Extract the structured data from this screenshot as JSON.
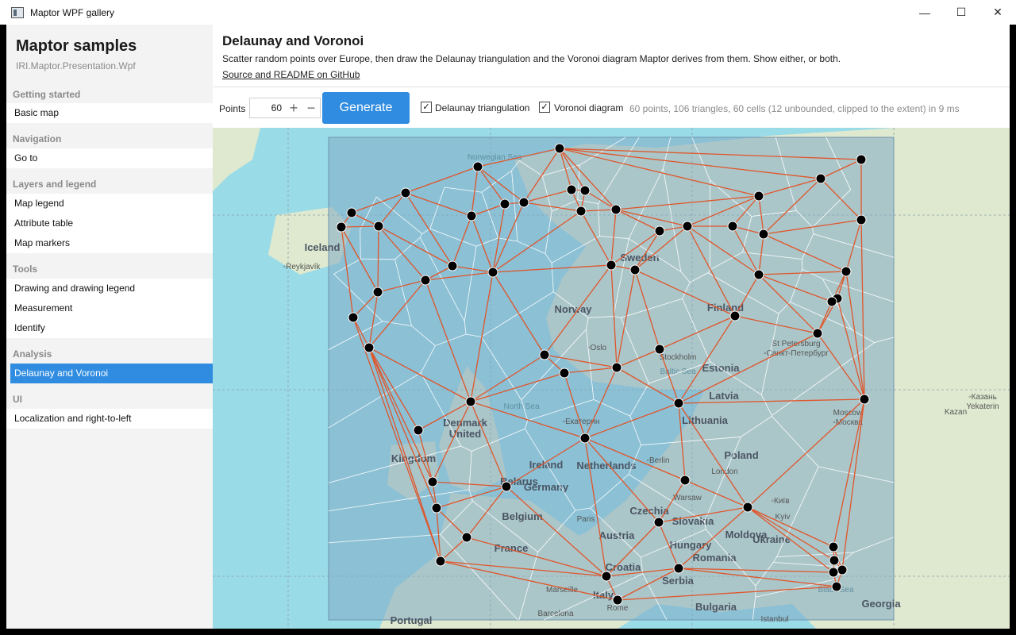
{
  "window": {
    "title": "Maptor WPF gallery",
    "controls": {
      "minimize": "—",
      "maximize": "☐",
      "close": "✕"
    }
  },
  "sidebar": {
    "title": "Maptor samples",
    "subtitle": "IRI.Maptor.Presentation.Wpf",
    "groups": [
      {
        "label": "Getting started",
        "items": [
          "Basic map"
        ]
      },
      {
        "label": "Navigation",
        "items": [
          "Go to"
        ]
      },
      {
        "label": "Layers and legend",
        "items": [
          "Map legend",
          "Attribute table",
          "Map markers"
        ]
      },
      {
        "label": "Tools",
        "items": [
          "Drawing and drawing legend",
          "Measurement",
          "Identify"
        ]
      },
      {
        "label": "Analysis",
        "items": [
          "Delaunay and Voronoi"
        ]
      },
      {
        "label": "UI",
        "items": [
          "Localization and right-to-left"
        ]
      }
    ],
    "active_item": "Delaunay and Voronoi"
  },
  "main": {
    "title": "Delaunay and Voronoi",
    "description": "Scatter random points over Europe, then draw the Delaunay triangulation and the Voronoi diagram Maptor derives from them. Show either, or both.",
    "link": "Source and README on GitHub",
    "toolbar": {
      "points_label": "Points",
      "points_value": "60",
      "plus": "+",
      "minus": "−",
      "generate_label": "Generate",
      "delaunay_label": "Delaunay triangulation",
      "delaunay_checked": true,
      "voronoi_label": "Voronoi diagram",
      "voronoi_checked": true,
      "status": "60 points, 106 triangles, 60 cells (12 unbounded, clipped to the extent) in 9 ms"
    }
  },
  "map": {
    "colors": {
      "water": "#9adbe8",
      "land": "#dfe9cf",
      "extent": "#7fa9c4",
      "delaunay": "#e0552a",
      "voronoi": "#ffffff",
      "point": "#000000"
    },
    "labels": [
      {
        "text": "Norwegian Sea",
        "kind": "sea"
      },
      {
        "text": "Iceland",
        "kind": "country"
      },
      {
        "text": "Reykjavík",
        "kind": "city"
      },
      {
        "text": "Sweden",
        "kind": "country"
      },
      {
        "text": "Norway",
        "kind": "country"
      },
      {
        "text": "Finland",
        "kind": "country"
      },
      {
        "text": "Oslo",
        "kind": "city"
      },
      {
        "text": "Stockholm",
        "kind": "city"
      },
      {
        "text": "Baltic Sea",
        "kind": "sea"
      },
      {
        "text": "St Petersburg",
        "kind": "city"
      },
      {
        "text": "Санкт-Петербург",
        "kind": "city"
      },
      {
        "text": "Estonia",
        "kind": "country"
      },
      {
        "text": "Latvia",
        "kind": "country"
      },
      {
        "text": "North Sea",
        "kind": "sea"
      },
      {
        "text": "Lithuania",
        "kind": "country"
      },
      {
        "text": "Moscow",
        "kind": "city"
      },
      {
        "text": "Москва",
        "kind": "city"
      },
      {
        "text": "Kazan",
        "kind": "city"
      },
      {
        "text": "Казань",
        "kind": "city"
      },
      {
        "text": "Yekaterin",
        "kind": "city"
      },
      {
        "text": "Екатерин",
        "kind": "city"
      },
      {
        "text": "Denmark",
        "kind": "country"
      },
      {
        "text": "United",
        "kind": "country"
      },
      {
        "text": "Kingdom",
        "kind": "country"
      },
      {
        "text": "Ireland",
        "kind": "country"
      },
      {
        "text": "Netherlands",
        "kind": "country"
      },
      {
        "text": "Berlin",
        "kind": "city"
      },
      {
        "text": "Poland",
        "kind": "country"
      },
      {
        "text": "Belarus",
        "kind": "country"
      },
      {
        "text": "London",
        "kind": "city"
      },
      {
        "text": "Germany",
        "kind": "country"
      },
      {
        "text": "Warsaw",
        "kind": "city"
      },
      {
        "text": "Belgium",
        "kind": "country"
      },
      {
        "text": "Kyiv",
        "kind": "city"
      },
      {
        "text": "Київ",
        "kind": "city"
      },
      {
        "text": "Paris",
        "kind": "city"
      },
      {
        "text": "Czechia",
        "kind": "country"
      },
      {
        "text": "Ukraine",
        "kind": "country"
      },
      {
        "text": "Slovakia",
        "kind": "country"
      },
      {
        "text": "Austria",
        "kind": "country"
      },
      {
        "text": "Moldova",
        "kind": "country"
      },
      {
        "text": "France",
        "kind": "country"
      },
      {
        "text": "Hungary",
        "kind": "country"
      },
      {
        "text": "Romania",
        "kind": "country"
      },
      {
        "text": "Croatia",
        "kind": "country"
      },
      {
        "text": "Marseille",
        "kind": "city"
      },
      {
        "text": "Serbia",
        "kind": "country"
      },
      {
        "text": "Black Sea",
        "kind": "sea"
      },
      {
        "text": "Italy",
        "kind": "country"
      },
      {
        "text": "Rome",
        "kind": "city"
      },
      {
        "text": "Bulgaria",
        "kind": "country"
      },
      {
        "text": "Barcelona",
        "kind": "city"
      },
      {
        "text": "Portugal",
        "kind": "country"
      },
      {
        "text": "Istanbul",
        "kind": "city"
      },
      {
        "text": "Georgia",
        "kind": "country"
      }
    ]
  }
}
